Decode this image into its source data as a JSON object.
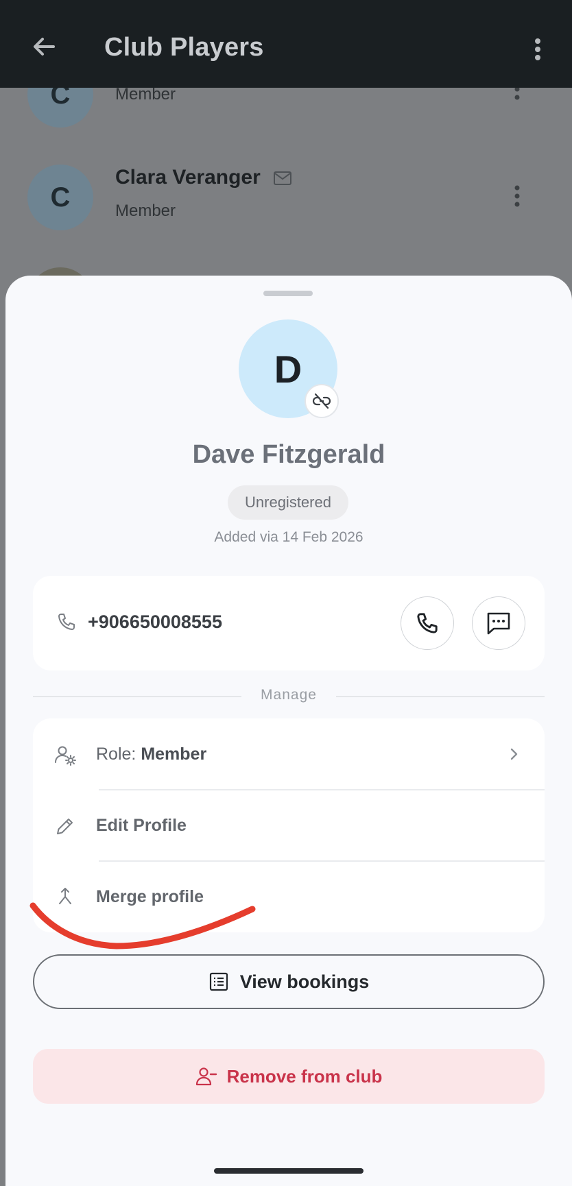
{
  "app_bar": {
    "title": "Club Players",
    "back_icon": "arrow-left-icon",
    "menu_icon": "more-vertical-icon"
  },
  "list": {
    "rows": [
      {
        "initial": "C",
        "role": "Member"
      },
      {
        "initial": "C",
        "name": "Clara Veranger",
        "role": "Member",
        "email_icon": "mail-icon"
      }
    ]
  },
  "profile": {
    "initial": "D",
    "name": "Dave Fitzgerald",
    "status": "Unregistered",
    "added": "Added via 14 Feb 2026",
    "link_status_icon": "link-off-icon"
  },
  "contact": {
    "phone": "+906650008555",
    "call_icon": "phone-icon",
    "message_icon": "message-icon"
  },
  "manage": {
    "section_label": "Manage",
    "role_prefix": "Role: ",
    "role_value": "Member",
    "edit_label": "Edit Profile",
    "merge_label": "Merge profile"
  },
  "actions": {
    "view_bookings": "View bookings",
    "remove": "Remove from club"
  },
  "colors": {
    "accent_danger": "#c9334a",
    "danger_bg": "#fbe6e8",
    "avatar_bg": "#cdeafb",
    "annotation_stroke": "#e53d2d"
  }
}
